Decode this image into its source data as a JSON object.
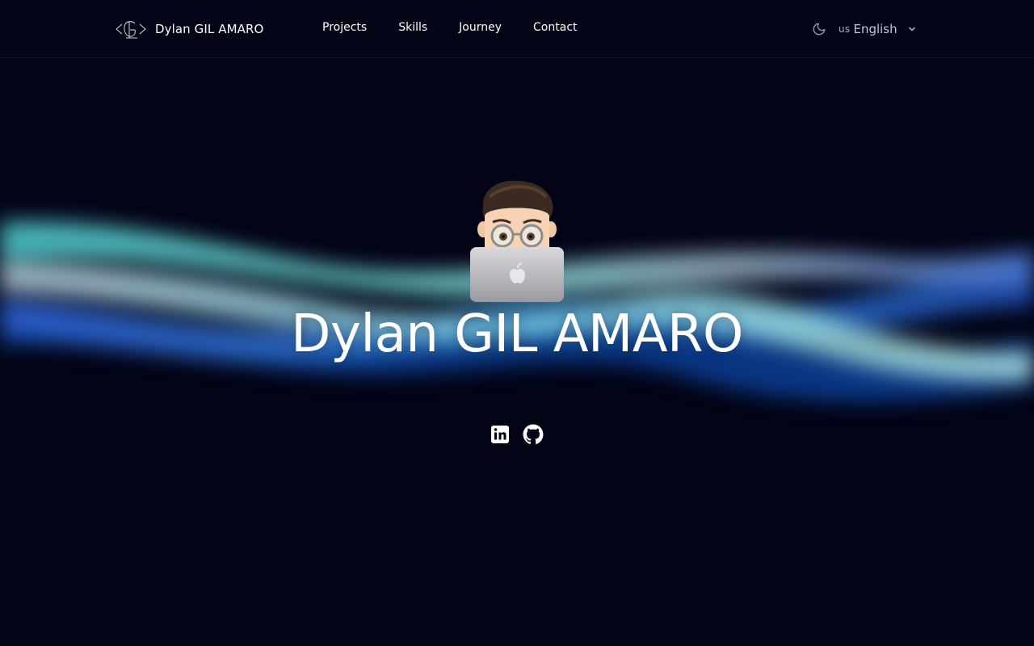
{
  "header": {
    "brand_name": "Dylan GIL AMARO",
    "nav": [
      {
        "label": "Projects"
      },
      {
        "label": "Skills"
      },
      {
        "label": "Journey"
      },
      {
        "label": "Contact"
      }
    ],
    "theme_icon": "moon-icon",
    "language": {
      "flag": "us",
      "label": "English"
    }
  },
  "hero": {
    "title": "Dylan GIL AMARO",
    "avatar": "memoji-avatar-with-laptop",
    "socials": [
      {
        "icon": "linkedin-icon"
      },
      {
        "icon": "github-icon"
      }
    ]
  },
  "colors": {
    "background": "#030416",
    "text": "#ffffff",
    "wave_teal": "#5fe0d8",
    "wave_blue": "#3a6fd8",
    "wave_deep": "#0b3f9a"
  }
}
